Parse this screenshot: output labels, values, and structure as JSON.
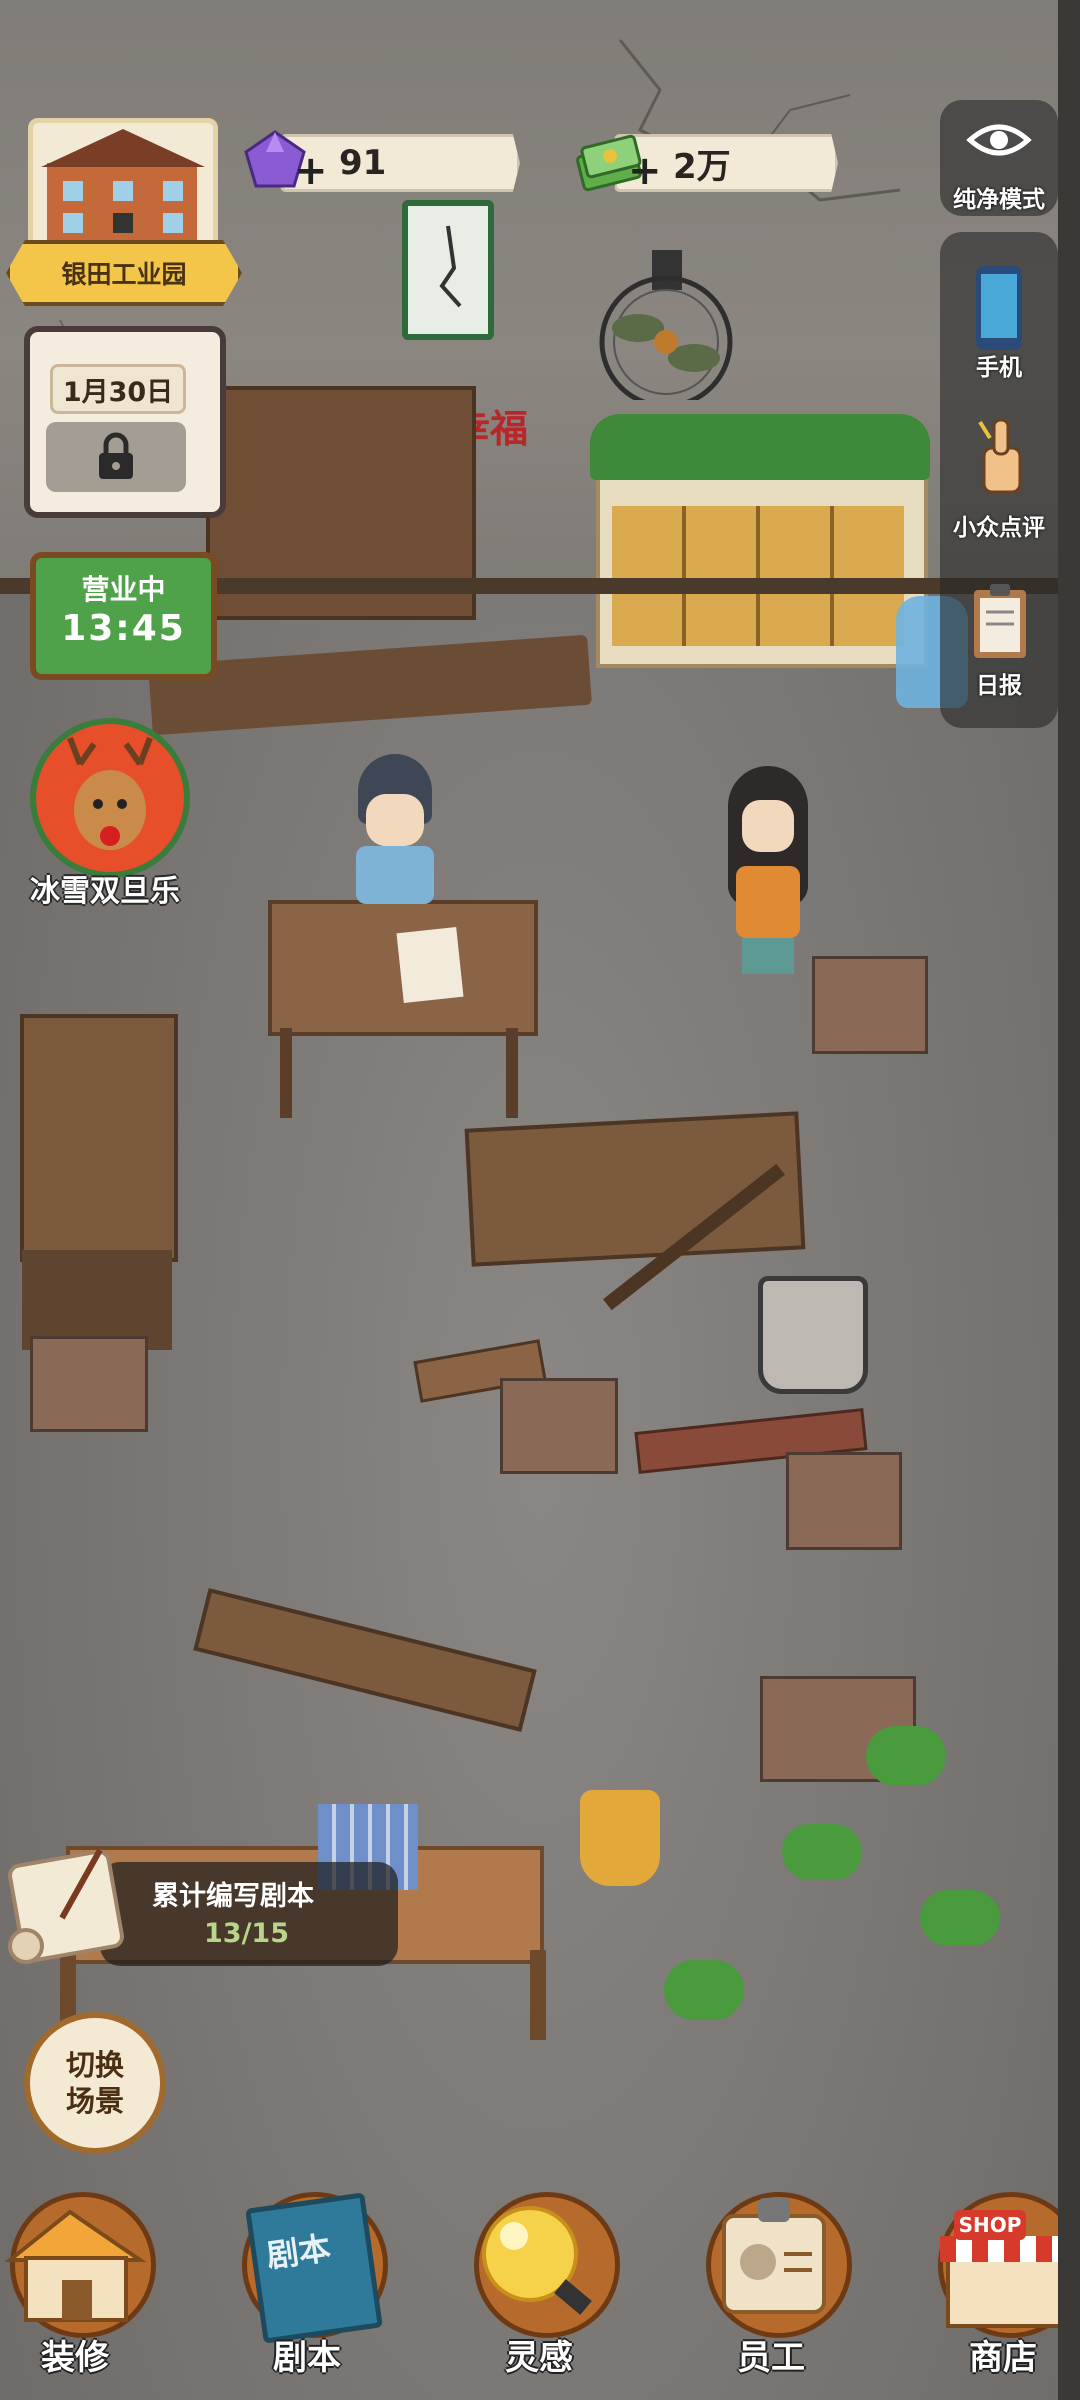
{
  "hud": {
    "location_name": "银田工业园",
    "gems": {
      "value": "91",
      "plus": "+"
    },
    "money": {
      "value": "2万",
      "plus": "+"
    },
    "calendar_date": "1月30日",
    "status": {
      "label": "营业中",
      "time": "13:45"
    },
    "event": {
      "label": "冰雪双旦乐"
    }
  },
  "scene": {
    "wall_sign": "幸福"
  },
  "sidebar": {
    "pure_mode": "纯净模式",
    "items": [
      {
        "label": "手机",
        "icon": "phone-icon"
      },
      {
        "label": "小众点评",
        "icon": "thumbs-up-icon"
      },
      {
        "label": "日报",
        "icon": "clipboard-icon"
      }
    ]
  },
  "script_progress": {
    "title": "累计编写剧本",
    "value": "13/15"
  },
  "switch_scene": {
    "line1": "切换",
    "line2": "场景"
  },
  "bottom_nav": [
    {
      "label": "装修",
      "icon": "house-icon"
    },
    {
      "label": "剧本",
      "icon": "book-icon",
      "book_text": "剧本"
    },
    {
      "label": "灵感",
      "icon": "lightbulb-icon"
    },
    {
      "label": "员工",
      "icon": "badge-icon"
    },
    {
      "label": "商店",
      "icon": "shop-icon",
      "sign_text": "SHOP"
    }
  ],
  "colors": {
    "floor": "#7b7875",
    "wood": "#7a5538",
    "status_green": "#4fa24a",
    "ribbon_gold": "#f3c64a"
  }
}
